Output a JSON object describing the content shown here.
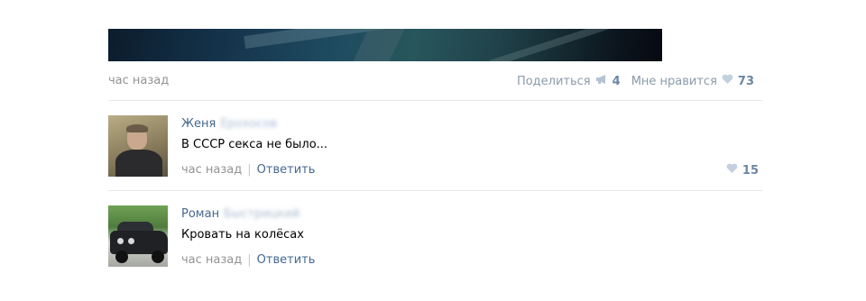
{
  "post": {
    "time": "час назад",
    "share_label": "Поделиться",
    "share_count": "4",
    "like_label": "Мне нравится",
    "like_count": "73"
  },
  "comments": [
    {
      "author_name": "Женя",
      "author_surname": "Ерохосов",
      "text": "В СССР секса не было...",
      "time": "час назад",
      "separator": "|",
      "reply_label": "Ответить",
      "like_count": "15"
    },
    {
      "author_name": "Роман",
      "author_surname": "Быстрицкий",
      "text": "Кровать на колёсах",
      "time": "час назад",
      "separator": "|",
      "reply_label": "Ответить"
    }
  ],
  "colors": {
    "link": "#45688e",
    "muted": "#939393",
    "count": "#6a86a4",
    "divider": "#e4e8ec"
  },
  "icons": {
    "share": "megaphone-icon",
    "like": "heart-icon"
  }
}
